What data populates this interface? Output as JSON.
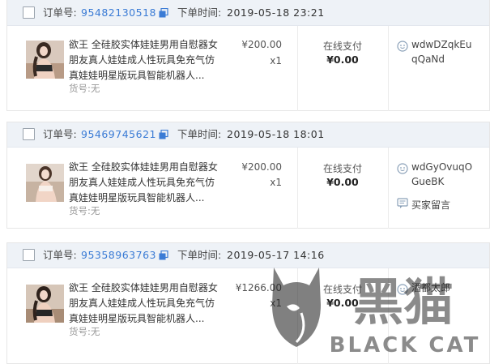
{
  "labels": {
    "order_no": "订单号:",
    "order_time": "下单时间:",
    "pay_method": "在线支付",
    "sku": "货号:无",
    "message": "买家留言"
  },
  "orders": [
    {
      "order_no": "95482130518",
      "time": "2019-05-18 23:21",
      "title": "欲王 全硅胶实体娃娃男用自慰器女朋友真人娃娃成人性玩具免充气仿真娃娃明星版玩具智能机器人...",
      "price": "¥200.00",
      "qty": "x1",
      "total": "¥0.00",
      "buyer": "wdwDZqkEuqQaNd"
    },
    {
      "order_no": "95469745621",
      "time": "2019-05-18 18:01",
      "title": "欲王 全硅胶实体娃娃男用自慰器女朋友真人娃娃成人性玩具免充气仿真娃娃明星版玩具智能机器人...",
      "price": "¥200.00",
      "qty": "x1",
      "total": "¥0.00",
      "buyer": "wdGyOvuqOGueBK"
    },
    {
      "order_no": "95358963763",
      "time": "2019-05-17 14:16",
      "title": "欲王 全硅胶实体娃娃男用自慰器女朋友真人娃娃成人性玩具免充气仿真娃娃明星版玩具智能机器人...",
      "price": "¥1266.00",
      "qty": "x1",
      "total": "¥0.00",
      "buyer": "酒都太郎"
    }
  ],
  "watermark": {
    "cn": "黑猫",
    "en": "BLACK CAT"
  },
  "colors": {
    "order_no": "#3a7bd5",
    "header_bg": "#eef2f7"
  }
}
